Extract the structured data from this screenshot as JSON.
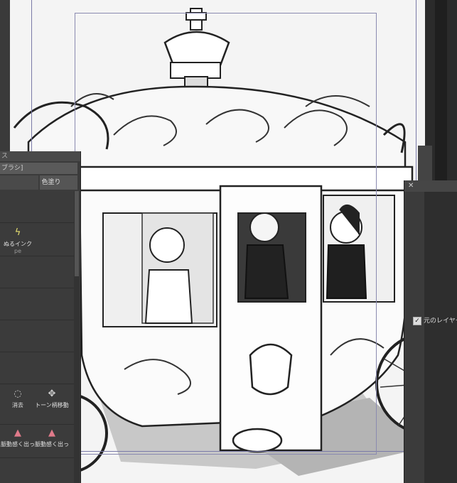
{
  "left_panel": {
    "header": "ス",
    "search_value": "ブラシ]",
    "tabs": [
      "",
      "色塗り"
    ],
    "tools": {
      "ink_label": "ぬるインク",
      "ink_suffix": "pe",
      "erase_label": "消去",
      "tone_move_label": "トーン柄移動",
      "tone_erase_a": "脈動感く出っ",
      "tone_erase_b": "脈動感く出っ"
    }
  },
  "right_dialog": {
    "close_label": "✕",
    "checkbox_label": "元のレイヤー",
    "checked": true
  },
  "colors": {
    "panel_bg": "#3b3b3b",
    "canvas_bg": "#f4f4f4",
    "guide_line": "#7a7aa8"
  }
}
